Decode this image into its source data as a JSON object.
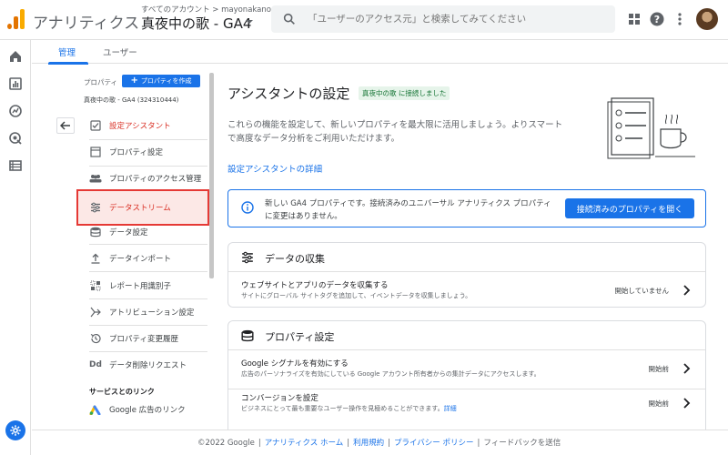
{
  "header": {
    "app_title": "アナリティクス",
    "account_path": "すべてのアカウント > mayonakanouta",
    "property_name": "真夜中の歌 - GA4",
    "search_placeholder": "「ユーザーのアクセス元」と検索してみてください"
  },
  "tabs": [
    {
      "label": "管理",
      "active": true
    },
    {
      "label": "ユーザー",
      "active": false
    }
  ],
  "nav": {
    "property_label": "プロパティ",
    "create_button": "プロパティを作成",
    "property_id": "真夜中の歌 - GA4 (324310444)",
    "items": [
      {
        "label": "設定アシスタント",
        "icon": "checkbox-icon",
        "active": true
      },
      {
        "label": "プロパティ設定",
        "icon": "window-icon",
        "active": false
      },
      {
        "label": "プロパティのアクセス管理",
        "icon": "people-icon",
        "active": false
      },
      {
        "label": "データストリーム",
        "icon": "streams-icon",
        "active": false
      },
      {
        "label": "データ設定",
        "icon": "database-icon",
        "active": false
      },
      {
        "label": "データインポート",
        "icon": "upload-icon",
        "active": false
      },
      {
        "label": "レポート用識別子",
        "icon": "identifier-icon",
        "active": false
      },
      {
        "label": "アトリビューション設定",
        "icon": "attribution-icon",
        "active": false
      },
      {
        "label": "プロパティ変更履歴",
        "icon": "history-icon",
        "active": false
      },
      {
        "label": "データ削除リクエスト",
        "icon": "dd-icon",
        "active": false
      }
    ],
    "links_section": "サービスとのリンク",
    "google_ads_link": "Google 広告のリンク"
  },
  "main": {
    "title": "アシスタントの設定",
    "connected_badge": "真夜中の歌 に接続しました",
    "description": "これらの機能を設定して、新しいプロパティを最大限に活用しましょう。よりスマートで高度なデータ分析をご利用いただけます。",
    "detail_link": "設定アシスタントの詳細",
    "info_message": "新しい GA4 プロパティです。接続済みのユニバーサル アナリティクス プロパティに変更はありません。",
    "open_button": "接続済みのプロパティを開く",
    "cards": [
      {
        "title": "データの収集",
        "rows": [
          {
            "title": "ウェブサイトとアプリのデータを収集する",
            "sub": "サイトにグローバル サイトタグを追加して、イベントデータを収集しましょう。",
            "link": "",
            "status": "開始していません"
          }
        ]
      },
      {
        "title": "プロパティ設定",
        "rows": [
          {
            "title": "Google シグナルを有効にする",
            "sub": "広告のパーソナライズを有効にしている Google アカウント所有者からの集計データにアクセスします。",
            "link": "",
            "status": "開始前"
          },
          {
            "title": "コンバージョンを設定",
            "sub": "ビジネスにとって最も重要なユーザー操作を見極めることができます。",
            "link": "詳細",
            "status": "開始前"
          }
        ]
      }
    ]
  },
  "footer": {
    "copyright": "©2022 Google",
    "home": "アナリティクス ホーム",
    "terms": "利用規約",
    "privacy": "プライバシー ポリシー",
    "feedback": "フィードバックを送信"
  },
  "colors": {
    "accent": "#1a73e8",
    "active_nav": "#d93025",
    "highlight_border": "#e53935",
    "badge_bg": "#e6f4ea",
    "badge_text": "#137333"
  }
}
